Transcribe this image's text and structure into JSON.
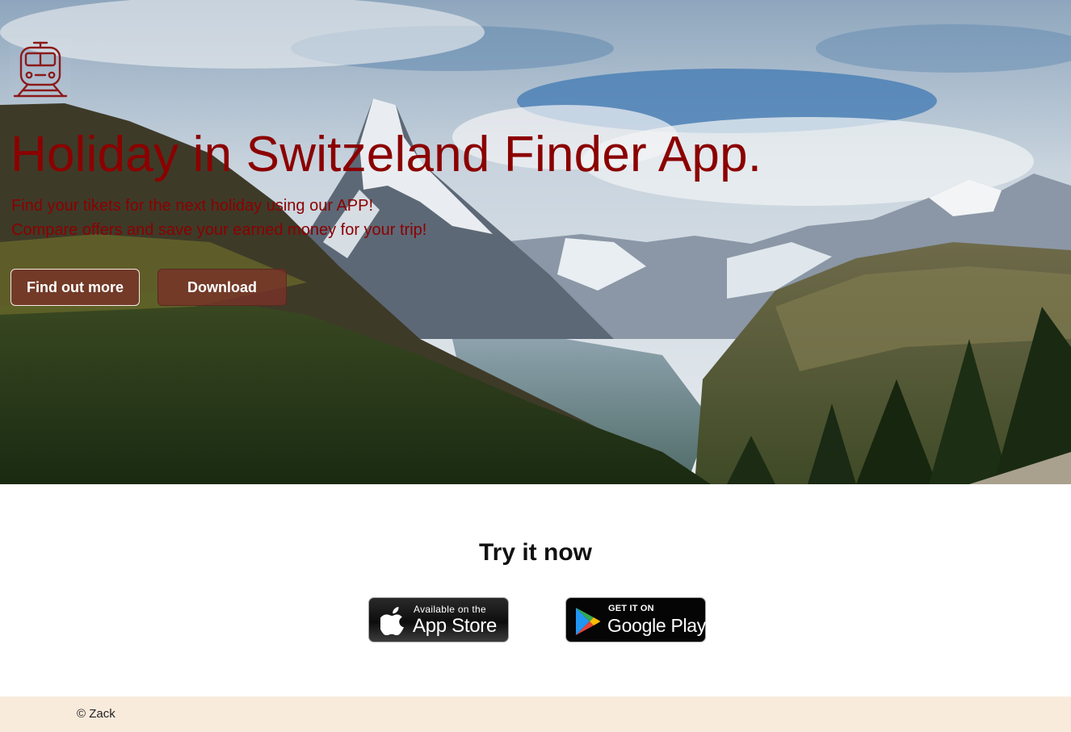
{
  "hero": {
    "logo_icon": "train-icon",
    "title": "Holiday in Switzeland Finder App.",
    "subtitle_line1": "Find your tikets for the next holiday using our APP!",
    "subtitle_line2": "Compare offers and save your earned money for your trip!",
    "buttons": [
      {
        "label": "Find out more"
      },
      {
        "label": "Download"
      }
    ],
    "background": "mountain-landscape-photo",
    "title_color": "#8b0000"
  },
  "try": {
    "title": "Try it now",
    "app_store": {
      "small": "Available on the",
      "big": "App Store",
      "icon": "apple-icon"
    },
    "google_play": {
      "small": "GET IT ON",
      "big": "Google Play",
      "icon": "google-play-icon"
    }
  },
  "footer": {
    "text": "© Zack",
    "background": "#f9ebdc"
  }
}
